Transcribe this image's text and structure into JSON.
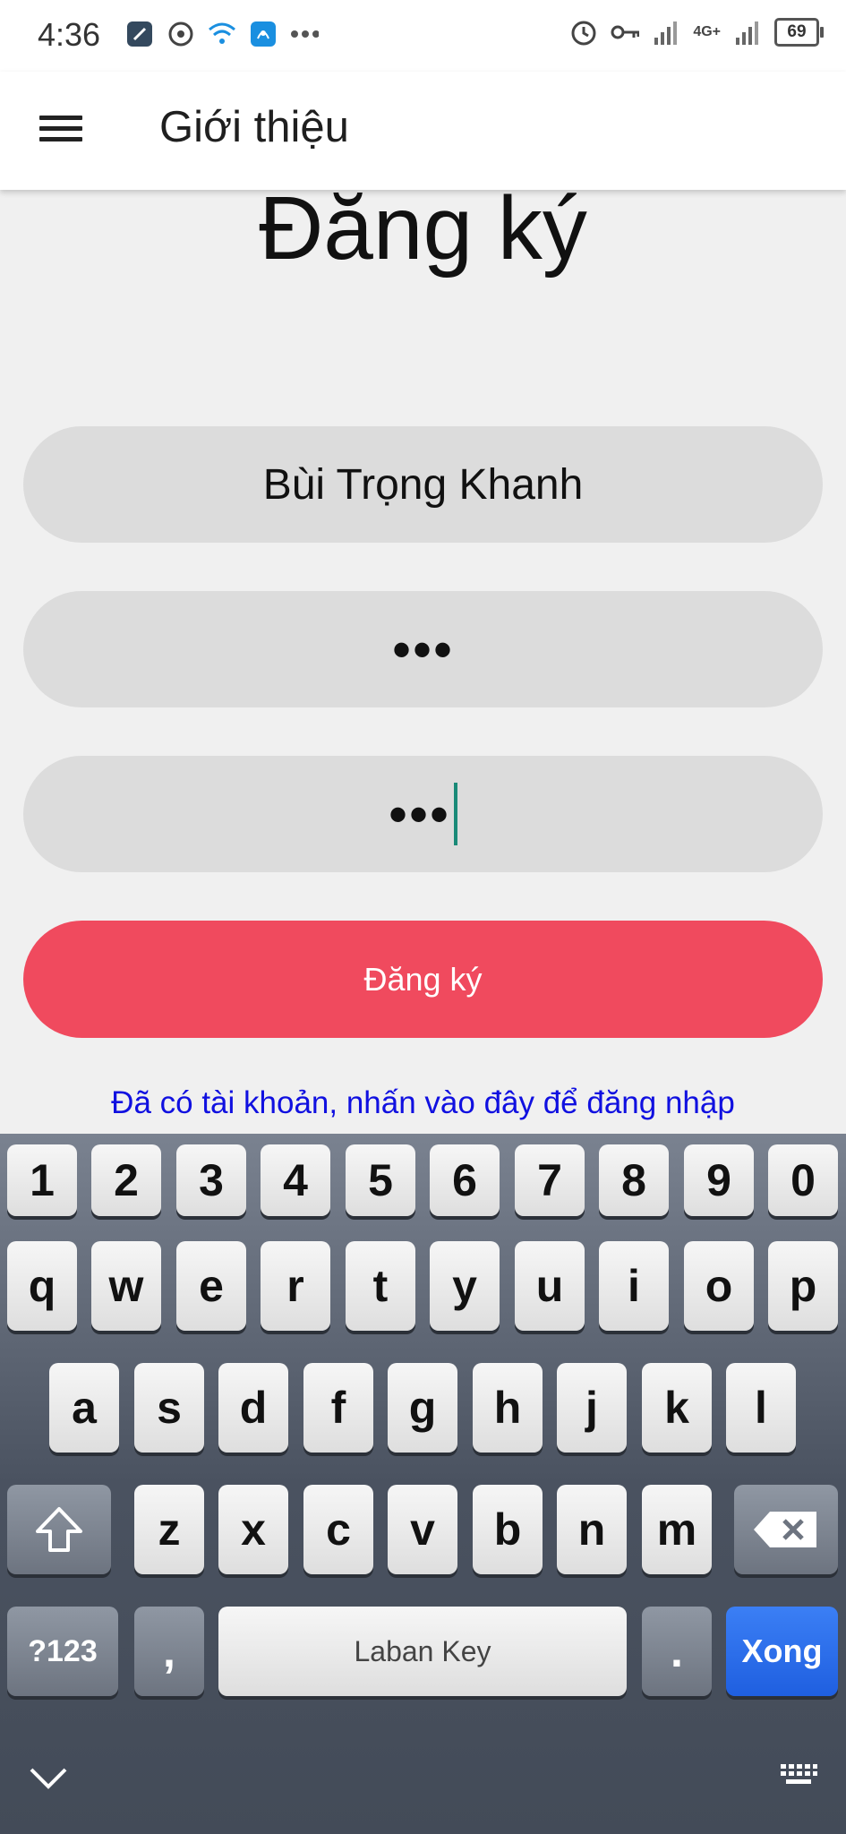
{
  "status_bar": {
    "time": "4:36",
    "battery": "69",
    "network": "4G+",
    "left_icons": [
      "app-icon",
      "settings-cog-icon",
      "wifi-icon",
      "hotspot-icon",
      "more-dots-icon"
    ],
    "right_icons": [
      "alarm-icon",
      "key-icon",
      "signal-icon",
      "signal-icon"
    ]
  },
  "app_bar": {
    "title": "Giới thiệu"
  },
  "form": {
    "heading": "Đăng ký",
    "username_value": "Bùi Trọng Khanh",
    "password_value": "•••",
    "confirm_value": "•••",
    "submit_label": "Đăng ký",
    "login_link": "Đã có tài khoản, nhấn vào đây để đăng nhập"
  },
  "keyboard": {
    "row_numbers": [
      "1",
      "2",
      "3",
      "4",
      "5",
      "6",
      "7",
      "8",
      "9",
      "0"
    ],
    "row1": [
      "q",
      "w",
      "e",
      "r",
      "t",
      "y",
      "u",
      "i",
      "o",
      "p"
    ],
    "row2": [
      "a",
      "s",
      "d",
      "f",
      "g",
      "h",
      "j",
      "k",
      "l"
    ],
    "row3": [
      "z",
      "x",
      "c",
      "v",
      "b",
      "n",
      "m"
    ],
    "symbols_label": "?123",
    "comma": ",",
    "space_label": "Laban Key",
    "period": ".",
    "done_label": "Xong"
  },
  "colors": {
    "submit": "#f04a5e",
    "link": "#1010e0",
    "field": "#dcdcdc",
    "done_key": "#1f5fe0"
  }
}
